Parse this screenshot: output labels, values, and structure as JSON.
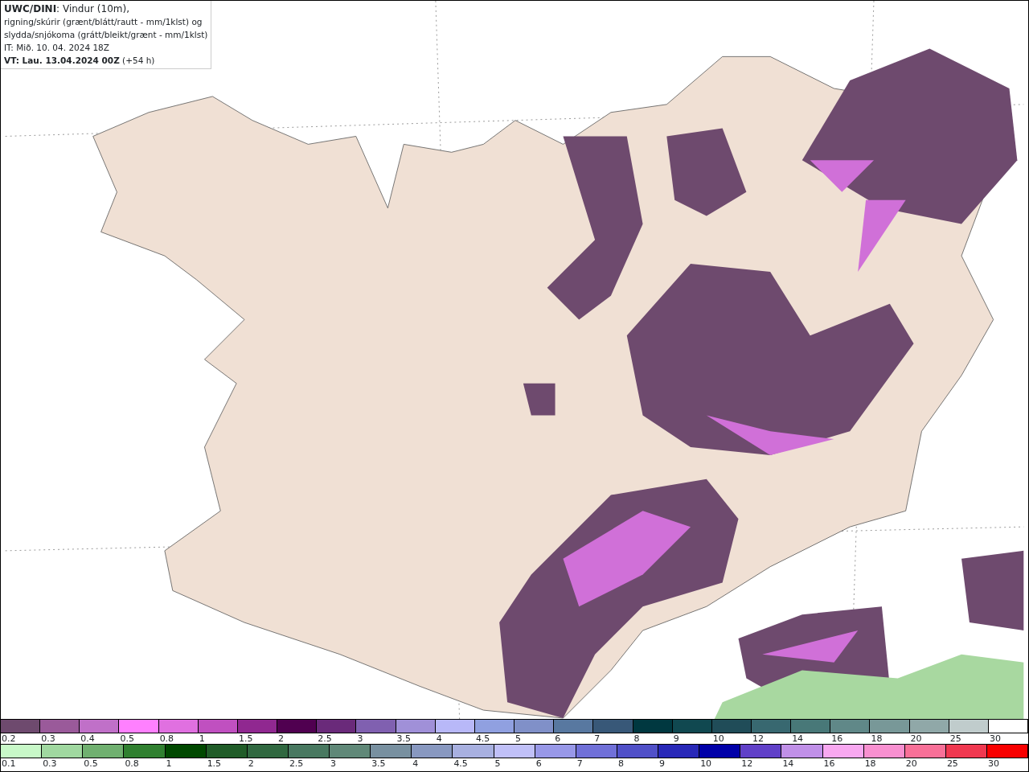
{
  "info_box": {
    "lines": [
      "**UWC/DINI**: Vindur (10m),",
      "rigning/skúrir (grænt/blátt/rautt - mm/1klst) og",
      "slydda/snjókoma (grátt/bleikt/grænt - mm/1klst)",
      "IT: Mið. 10. 04. 2024 18Z",
      "**VT: Lau. 13.04.2024 00Z** (+54 h)"
    ]
  },
  "scale_1": [
    {
      "label": "0.2",
      "color": "#6e4a6e"
    },
    {
      "label": "0.3",
      "color": "#9a5a9a"
    },
    {
      "label": "0.4",
      "color": "#c070c8"
    },
    {
      "label": "0.5",
      "color": "#ff80ff"
    },
    {
      "label": "0.8",
      "color": "#e070e0"
    },
    {
      "label": "1",
      "color": "#c050c0"
    },
    {
      "label": "1.5",
      "color": "#902890"
    },
    {
      "label": "2",
      "color": "#500050"
    },
    {
      "label": "2.5",
      "color": "#6a2a7a"
    },
    {
      "label": "3",
      "color": "#8060b0"
    },
    {
      "label": "3.5",
      "color": "#a090d8"
    },
    {
      "label": "4",
      "color": "#b8b8f8"
    },
    {
      "label": "4.5",
      "color": "#90a0e0"
    },
    {
      "label": "5",
      "color": "#8090c8"
    },
    {
      "label": "6",
      "color": "#5878a0"
    },
    {
      "label": "7",
      "color": "#385878"
    },
    {
      "label": "8",
      "color": "#003840"
    },
    {
      "label": "9",
      "color": "#104850"
    },
    {
      "label": "10",
      "color": "#204c58"
    },
    {
      "label": "12",
      "color": "#386870"
    },
    {
      "label": "14",
      "color": "#487878"
    },
    {
      "label": "16",
      "color": "#608888"
    },
    {
      "label": "18",
      "color": "#789898"
    },
    {
      "label": "20",
      "color": "#90a8a8"
    },
    {
      "label": "25",
      "color": "#c0cccc"
    },
    {
      "label": "30",
      "color": "#ffffff"
    }
  ],
  "scale_2": [
    {
      "label": "0.1",
      "color": "#c8f8c8"
    },
    {
      "label": "0.3",
      "color": "#a0d8a0"
    },
    {
      "label": "0.5",
      "color": "#70b070"
    },
    {
      "label": "0.8",
      "color": "#308030"
    },
    {
      "label": "1",
      "color": "#004800"
    },
    {
      "label": "1.5",
      "color": "#205c28"
    },
    {
      "label": "2",
      "color": "#306840"
    },
    {
      "label": "2.5",
      "color": "#487860"
    },
    {
      "label": "3",
      "color": "#608878"
    },
    {
      "label": "3.5",
      "color": "#7890a0"
    },
    {
      "label": "4",
      "color": "#8898c0"
    },
    {
      "label": "4.5",
      "color": "#a8b0e0"
    },
    {
      "label": "5",
      "color": "#c0c0f8"
    },
    {
      "label": "6",
      "color": "#9898e8"
    },
    {
      "label": "7",
      "color": "#7070d8"
    },
    {
      "label": "8",
      "color": "#5050c8"
    },
    {
      "label": "9",
      "color": "#2828b8"
    },
    {
      "label": "10",
      "color": "#0000a8"
    },
    {
      "label": "12",
      "color": "#6040c8"
    },
    {
      "label": "14",
      "color": "#c090e8"
    },
    {
      "label": "16",
      "color": "#f8a8f0"
    },
    {
      "label": "18",
      "color": "#f890d0"
    },
    {
      "label": "20",
      "color": "#f87098"
    },
    {
      "label": "25",
      "color": "#f03850"
    },
    {
      "label": "30",
      "color": "#f80000"
    }
  ]
}
